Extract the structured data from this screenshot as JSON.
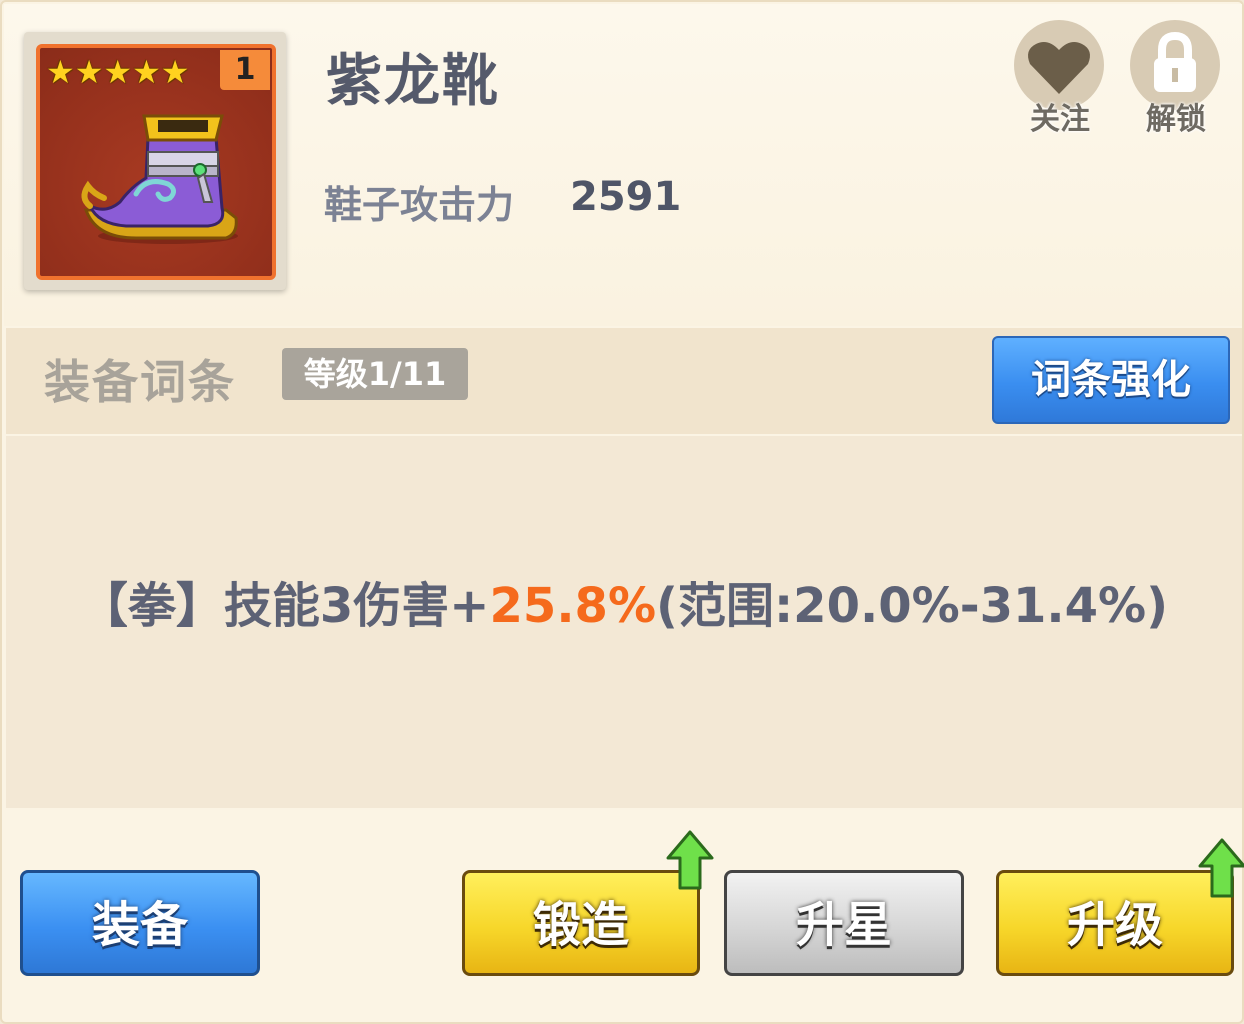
{
  "item": {
    "name": "紫龙靴",
    "stars": "★★★★★",
    "count": "1",
    "stat_label": "鞋子攻击力",
    "stat_value": "2591"
  },
  "actions": {
    "follow_label": "关注",
    "unlock_label": "解锁"
  },
  "affix": {
    "title": "装备词条",
    "level": "等级1/11",
    "enhance_label": "词条强化",
    "line_prefix": "【拳】技能3伤害+",
    "line_value": "25.8%",
    "line_range": "(范围:20.0%-31.4%)"
  },
  "buttons": {
    "equip": "装备",
    "forge": "锻造",
    "star_up": "升星",
    "level_up": "升级"
  },
  "colors": {
    "accent_orange": "#f56a1c",
    "blue_button": "#3a8ef0",
    "yellow_button": "#f7d72a",
    "card_border": "#f0722e"
  }
}
